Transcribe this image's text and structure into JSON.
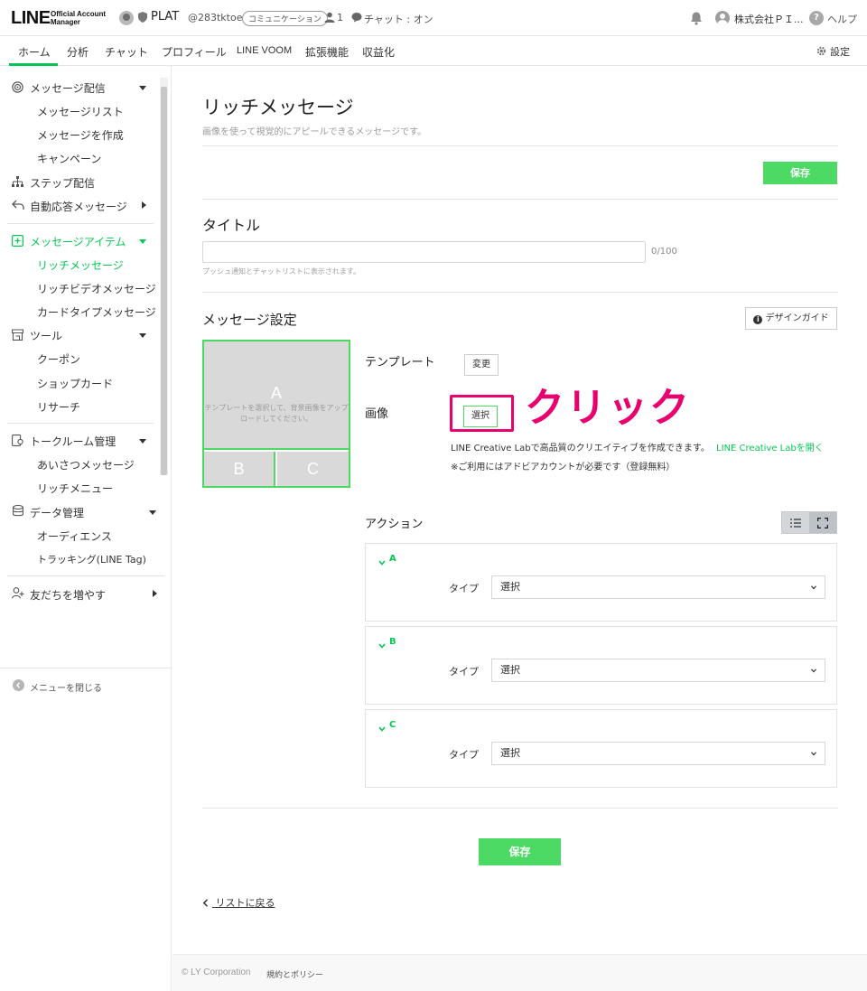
{
  "topbar": {
    "logo": "LINE",
    "logo_sub_1": "Official Account",
    "logo_sub_2": "Manager",
    "account_name": "PLAT",
    "account_id": "@283tktoe",
    "category": "コミュニケーション",
    "friends_count": "1",
    "chat_status": "チャット : オン",
    "company": "株式会社ＰＩ...",
    "help": "ヘルプ"
  },
  "tabs": {
    "home": "ホーム",
    "analytics": "分析",
    "chat": "チャット",
    "profile": "プロフィール",
    "voom": "LINE VOOM",
    "extensions": "拡張機能",
    "monetize": "収益化",
    "settings": "設定"
  },
  "sidebar": {
    "message_delivery": "メッセージ配信",
    "message_list": "メッセージリスト",
    "create_message": "メッセージを作成",
    "campaign": "キャンペーン",
    "step_delivery": "ステップ配信",
    "auto_response": "自動応答メッセージ",
    "message_items": "メッセージアイテム",
    "rich_message": "リッチメッセージ",
    "rich_video": "リッチビデオメッセージ",
    "card_type": "カードタイプメッセージ",
    "tools": "ツール",
    "coupon": "クーポン",
    "shop_card": "ショップカード",
    "research": "リサーチ",
    "talk_room": "トークルーム管理",
    "greeting": "あいさつメッセージ",
    "rich_menu": "リッチメニュー",
    "data_mgmt": "データ管理",
    "audience": "オーディエンス",
    "tracking": "トラッキング(LINE Tag)",
    "grow_friends": "友だちを増やす",
    "close_menu": "メニューを閉じる"
  },
  "main": {
    "page_title": "リッチメッセージ",
    "page_subtitle": "画像を使って視覚的にアピールできるメッセージです。",
    "save_top": "保存",
    "title_label": "タイトル",
    "title_value": "",
    "title_counter": "0/100",
    "title_help": "プッシュ通知とチャットリストに表示されます。",
    "settings_label": "メッセージ設定",
    "design_guide": "デザインガイド",
    "template_label": "テンプレート",
    "template_change": "変更",
    "image_label": "画像",
    "image_select": "選択",
    "click_annotation": "クリック",
    "preview_a": "A",
    "preview_b": "B",
    "preview_c": "C",
    "preview_hint": "テンプレートを選択して、背景画像をアップロードしてください。",
    "creative_lab_text": "LINE Creative Labで高品質のクリエイティブを作成できます。",
    "creative_lab_link": "LINE Creative Labを開く",
    "adobe_note": "※ご利用にはアドビアカウントが必要です（登録無料）",
    "actions_label": "アクション",
    "actions": [
      {
        "letter": "A",
        "type_label": "タイプ",
        "type_value": "選択"
      },
      {
        "letter": "B",
        "type_label": "タイプ",
        "type_value": "選択"
      },
      {
        "letter": "C",
        "type_label": "タイプ",
        "type_value": "選択"
      }
    ],
    "save_bottom": "保存",
    "back_link": "リストに戻る"
  },
  "footer": {
    "copyright": "© LY Corporation",
    "policy": "規約とポリシー"
  },
  "colors": {
    "brand_green": "#06c755",
    "save_button": "#4cd964",
    "annotation_pink": "#e8006e"
  }
}
